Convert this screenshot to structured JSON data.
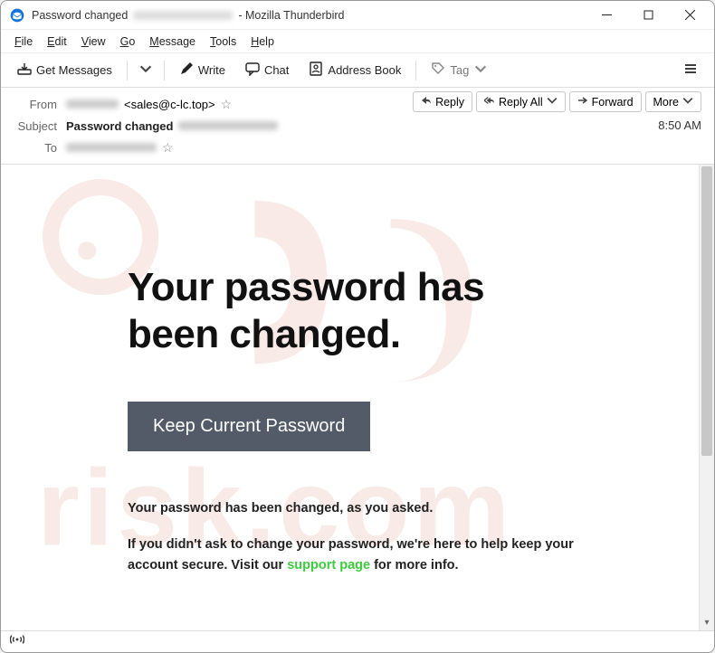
{
  "window": {
    "title_prefix": "Password changed",
    "title_suffix": "- Mozilla Thunderbird"
  },
  "menu": {
    "file": "File",
    "edit": "Edit",
    "view": "View",
    "go": "Go",
    "message": "Message",
    "tools": "Tools",
    "help": "Help"
  },
  "toolbar": {
    "get_messages": "Get Messages",
    "write": "Write",
    "chat": "Chat",
    "address_book": "Address Book",
    "tag": "Tag"
  },
  "header": {
    "from_label": "From",
    "from_value": "<sales@c-lc.top>",
    "subject_label": "Subject",
    "subject_value": "Password changed",
    "to_label": "To",
    "time": "8:50 AM"
  },
  "actions": {
    "reply": "Reply",
    "reply_all": "Reply All",
    "forward": "Forward",
    "more": "More"
  },
  "email": {
    "heading_l1": "Your password has",
    "heading_l2": "been changed.",
    "button": "Keep Current Password",
    "p1": "Your password has been changed, as you asked.",
    "p2a": "If you didn't ask to change your password, we're here to help keep your account secure. Visit our ",
    "p2_link": "support page",
    "p2b": " for more info."
  }
}
